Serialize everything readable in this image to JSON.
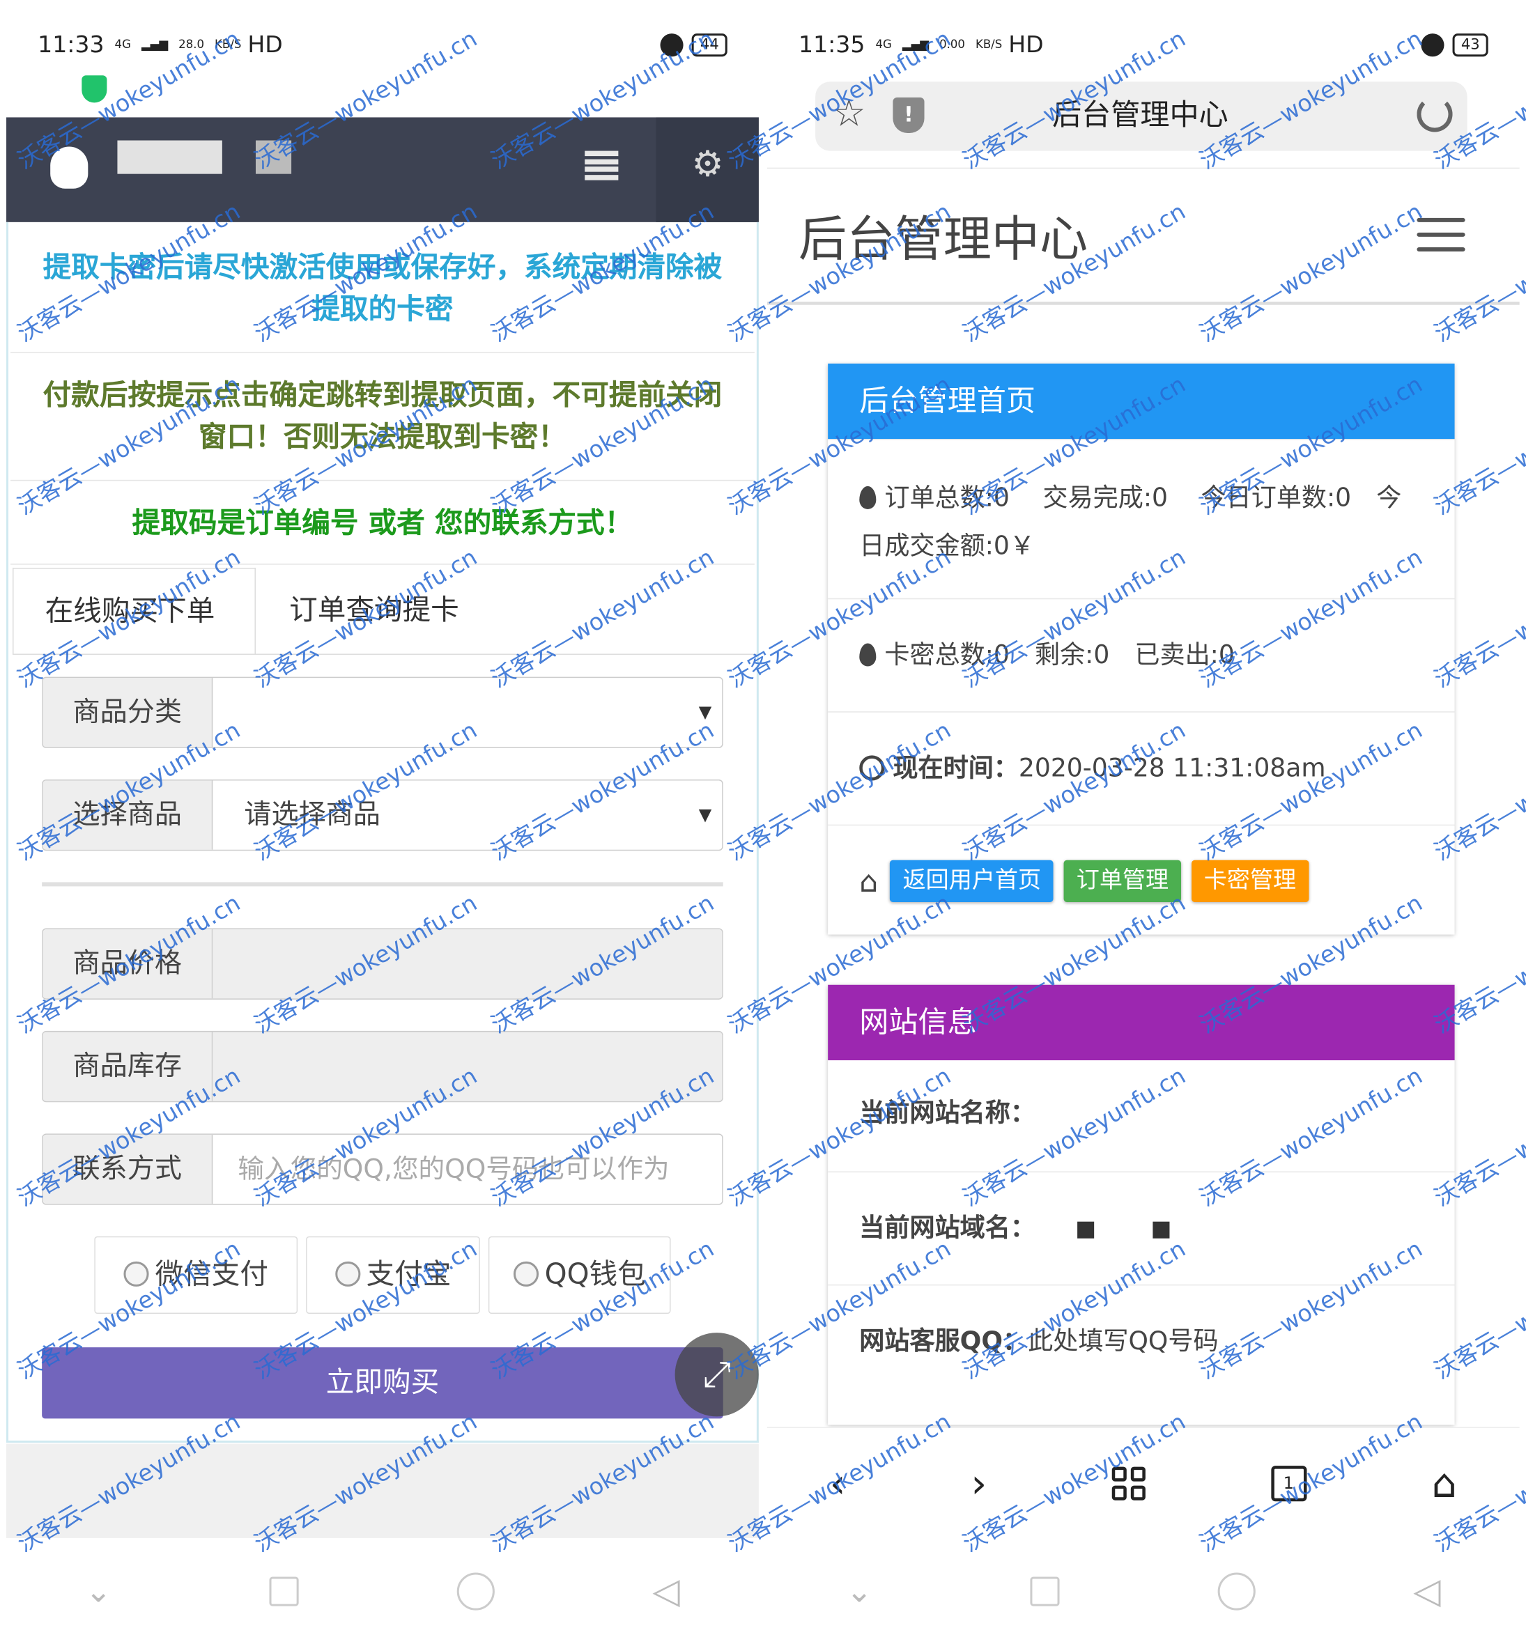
{
  "left": {
    "status": {
      "time": "11:33",
      "net": "4G",
      "speed_value": "28.0",
      "speed_unit": "KB/S",
      "hd": "HD",
      "battery": "44"
    },
    "notices": [
      "提取卡密后请尽快激活使用或保存好，系统定期清除被提取的卡密",
      "付款后按提示点击确定跳转到提取页面，不可提前关闭窗口！否则无法提取到卡密！",
      "提取码是订单编号 或者 您的联系方式！"
    ],
    "tabs": [
      "在线购买下单",
      "订单查询提卡"
    ],
    "form": {
      "category_label": "商品分类",
      "category_value": "",
      "product_label": "选择商品",
      "product_value": "请选择商品",
      "price_label": "商品价格",
      "stock_label": "商品库存",
      "contact_label": "联系方式",
      "contact_placeholder": "输入您的QQ,您的QQ号码也可以作为"
    },
    "payments": [
      "微信支付",
      "支付宝",
      "QQ钱包"
    ],
    "buy_label": "立即购买",
    "fab_icon": "expand-arrows-icon"
  },
  "right": {
    "status": {
      "time": "11:35",
      "net": "4G",
      "speed_value": "0.00",
      "speed_unit": "KB/S",
      "hd": "HD",
      "battery": "43"
    },
    "url_title": "后台管理中心",
    "page_title": "后台管理中心",
    "card1": {
      "title": "后台管理首页",
      "row1": "订单总数:0　 交易完成:0　 今日订单数:0　今日成交金额:0￥",
      "row2": "卡密总数:0　剩余:0　已卖出:0",
      "time_label": "现在时间：",
      "time_value": "2020-03-28 11:31:08am",
      "buttons": [
        "返回用户首页",
        "订单管理",
        "卡密管理"
      ]
    },
    "card2": {
      "title": "网站信息",
      "site_name_label": "当前网站名称：",
      "site_domain_label": "当前网站域名：",
      "service_qq_label": "网站客服QQ：",
      "service_qq_value": "此处填写QQ号码"
    },
    "tab_count": "1"
  },
  "watermark": {
    "cn": "沃客云",
    "domain": "wokeyunfu.cn"
  },
  "colors": {
    "blue": "#2196f3",
    "purple": "#9c27b0",
    "green": "#4caf50",
    "orange": "#ff9800",
    "buy": "#7265bc",
    "topbar": "#3d4252"
  }
}
